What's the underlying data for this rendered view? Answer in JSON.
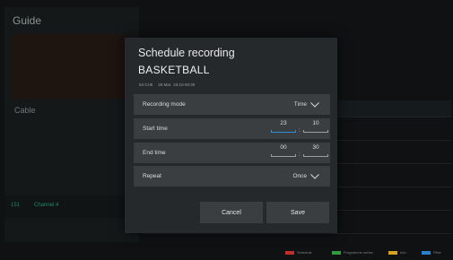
{
  "guide": {
    "title": "Guide",
    "source": "Cable",
    "channel": {
      "number": "151",
      "name": "Channel 4"
    }
  },
  "legend": [
    {
      "label": "Schedule",
      "color": "#c0302b"
    },
    {
      "label": "Programme series",
      "color": "#2f9a3e"
    },
    {
      "label": "Info",
      "color": "#d6a21f"
    },
    {
      "label": "Filter",
      "color": "#2a7fd0"
    }
  ],
  "dialog": {
    "title": "Schedule recording",
    "program": "BASKETBALL",
    "info": {
      "channel": "53 CH5",
      "date": "26 Mar.",
      "time_range": "23:10-00:30"
    },
    "rows": {
      "recording_mode": {
        "label": "Recording mode",
        "value": "Time"
      },
      "start_time": {
        "label": "Start time",
        "hour": "23",
        "minute": "10"
      },
      "end_time": {
        "label": "End time",
        "hour": "00",
        "minute": "30"
      },
      "repeat": {
        "label": "Repeat",
        "value": "Once"
      }
    },
    "time_separator": ":",
    "buttons": {
      "cancel": "Cancel",
      "save": "Save"
    }
  },
  "colors": {
    "accent": "#2d8fd6",
    "dialog_bg": "#26292b",
    "row_bg": "#3a3e40"
  }
}
